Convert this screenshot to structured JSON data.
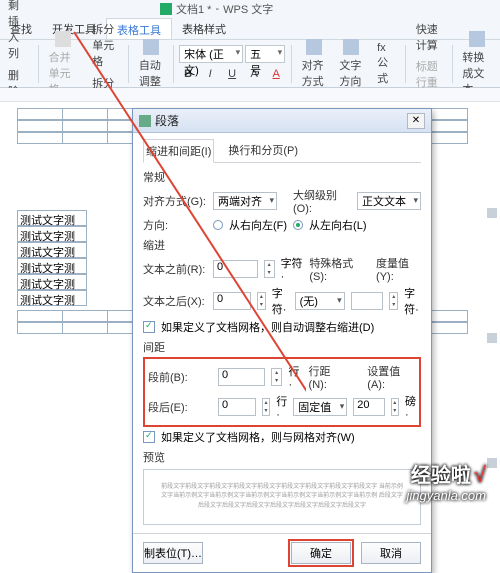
{
  "titlebar": {
    "doc": "文档1 *",
    "app": "WPS 文字"
  },
  "ribbon_tabs": [
    "查找",
    "开发工具",
    "表格工具",
    "表格样式"
  ],
  "ribbon_active": 2,
  "ribbon": {
    "insert_row": "剩插入列",
    "delete_row": "删除入列",
    "merge": "合并单元格",
    "split_cell": "拆分单元格",
    "split_table": "拆分表格",
    "autofit": "自动调整",
    "font_name": "宋体 (正文)",
    "font_size": "五号",
    "bold": "B",
    "italic": "I",
    "underline": "U",
    "strike": "A",
    "align": "对齐方式",
    "text_dir": "文字方向",
    "formula": "fx 公式",
    "quick_calc": "快速计算",
    "title_repeat": "标题行重复",
    "convert": "转换成文本"
  },
  "table": {
    "rows": [
      "测试文字测",
      "测试文字测",
      "测试文字测",
      "测试文字测",
      "测试文字测",
      "测试文字测"
    ]
  },
  "dialog": {
    "title": "段落",
    "tabs": [
      "缩进和间距(I)",
      "换行和分页(P)"
    ],
    "grp_general": "常规",
    "align_label": "对齐方式(G):",
    "align_value": "两端对齐",
    "outline_label": "大纲级别(O):",
    "outline_value": "正文文本",
    "dir_label": "方向:",
    "dir_rtl": "从右向左(F)",
    "dir_ltr": "从左向右(L)",
    "grp_indent": "缩进",
    "before_text": "文本之前(R):",
    "after_text": "文本之后(X):",
    "char_unit": "字符·",
    "special_label": "特殊格式(S):",
    "special_value": "(无)",
    "meas_label": "度量值(Y):",
    "indent_check": "如果定义了文档网格，则自动调整右缩进(D)",
    "grp_spacing": "间距",
    "space_before": "段前(B):",
    "space_after": "段后(E):",
    "line_unit": "行·",
    "line_spacing_label": "行距(N):",
    "line_spacing_value": "固定值",
    "setting_label": "设置值(A):",
    "setting_value": "20",
    "setting_unit": "磅·",
    "spacing_check": "如果定义了文档网格，则与网格对齐(W)",
    "grp_preview": "预览",
    "preview_text": "前段文字前段文字前段文字前段文字前段文字前段文字前段文字前段文字前段文字 当前示例文字当前示例文字当前示例文字当前示例文字当前示例文字当前示例文字当前示例 后段文字后段文字后段文字后段文字后段文字后段文字后段文字后段文字",
    "tabstop": "制表位(T)…",
    "ok": "确定",
    "cancel": "取消",
    "zero": "0"
  },
  "watermark": {
    "zh": "经验啦",
    "en": "jingyanla.com"
  }
}
